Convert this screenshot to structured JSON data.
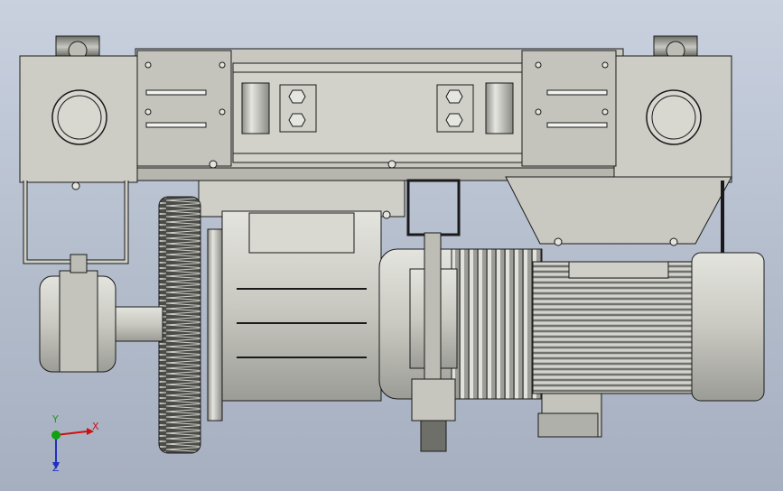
{
  "view": {
    "background_top": "#c9d1df",
    "background_bottom": "#a6afc0",
    "part_color": "#cfcfc8",
    "shade_color": "#9e9e98",
    "edge_color": "#1a1a1a"
  },
  "triad": {
    "x_label": "X",
    "y_label": "Y",
    "z_label": "Z",
    "x_color": "#d01010",
    "y_color": "#10a010",
    "z_color": "#2030c0"
  }
}
